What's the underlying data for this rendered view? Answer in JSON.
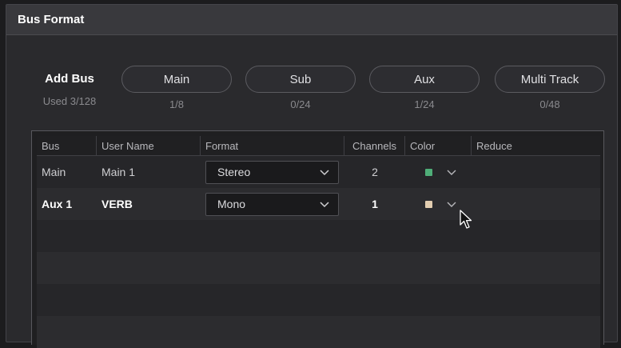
{
  "window": {
    "title": "Bus Format"
  },
  "add_bus": {
    "label": "Add Bus",
    "used": "Used 3/128",
    "buttons": [
      {
        "label": "Main",
        "count": "1/8"
      },
      {
        "label": "Sub",
        "count": "0/24"
      },
      {
        "label": "Aux",
        "count": "1/24"
      },
      {
        "label": "Multi Track",
        "count": "0/48"
      }
    ]
  },
  "table": {
    "columns": [
      "Bus",
      "User Name",
      "Format",
      "Channels",
      "Color",
      "Reduce"
    ],
    "rows": [
      {
        "bus": "Main",
        "user_name": "Main 1",
        "format": "Stereo",
        "channels": "2",
        "color": "#4fae78"
      },
      {
        "bus": "Aux 1",
        "user_name": "VERB",
        "format": "Mono",
        "channels": "1",
        "color": "#e2cdb0"
      }
    ]
  },
  "icons": {
    "dropdown": "chevron-down-icon",
    "cursor": "mouse-pointer-icon"
  }
}
